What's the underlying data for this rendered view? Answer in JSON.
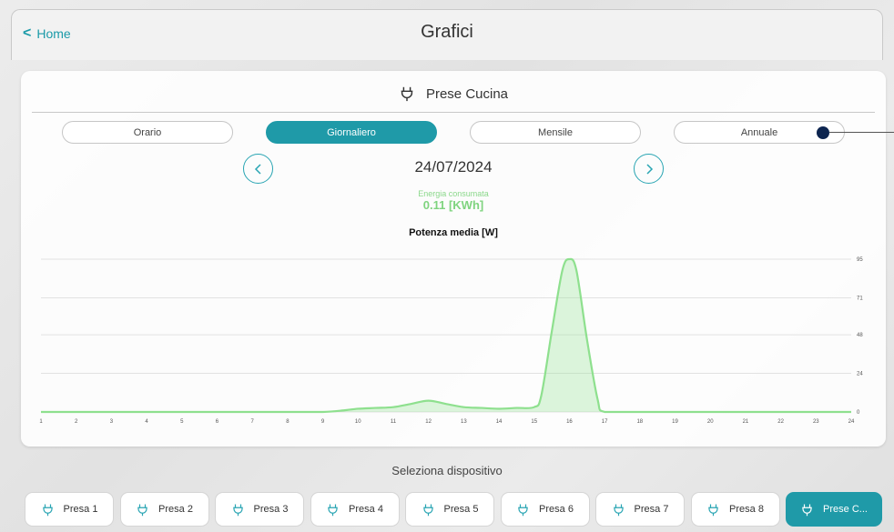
{
  "header": {
    "back_label": "Home",
    "title": "Grafici"
  },
  "device": {
    "name": "Prese Cucina"
  },
  "period_tabs": [
    {
      "label": "Orario",
      "active": false
    },
    {
      "label": "Giornaliero",
      "active": true
    },
    {
      "label": "Mensile",
      "active": false
    },
    {
      "label": "Annuale",
      "active": false
    }
  ],
  "date": "24/07/2024",
  "energy": {
    "label": "Energia consumata",
    "value": "0.11 [KWh]"
  },
  "chart_data": {
    "type": "area",
    "title": "Potenza media [W]",
    "xlabel": "",
    "ylabel": "",
    "x_ticks": [
      "1",
      "2",
      "3",
      "4",
      "5",
      "6",
      "7",
      "8",
      "9",
      "10",
      "11",
      "12",
      "13",
      "14",
      "15",
      "16",
      "17",
      "18",
      "19",
      "20",
      "21",
      "22",
      "23",
      "24"
    ],
    "y_ticks": [
      "0",
      "24",
      "48",
      "71",
      "95"
    ],
    "ylim": [
      0,
      95
    ],
    "grid": true,
    "color": "#8ee08e",
    "x": [
      1,
      2,
      3,
      4,
      5,
      6,
      7,
      8,
      9,
      9.6,
      10,
      10.5,
      11,
      11.5,
      12,
      12.5,
      13,
      13.5,
      14,
      14.5,
      15,
      15.2,
      15.5,
      15.8,
      16,
      16.2,
      16.5,
      16.8,
      17,
      18,
      19,
      20,
      21,
      22,
      23,
      24
    ],
    "y": [
      0,
      0,
      0,
      0,
      0,
      0,
      0,
      0,
      0,
      1,
      2,
      2.5,
      3,
      5,
      7,
      5,
      3,
      2.5,
      2,
      2.5,
      3,
      10,
      50,
      88,
      95,
      88,
      45,
      8,
      0,
      0,
      0,
      0,
      0,
      0,
      0,
      0
    ]
  },
  "selector": {
    "label": "Seleziona dispositivo",
    "devices": [
      {
        "label": "Presa 1",
        "active": false
      },
      {
        "label": "Presa 2",
        "active": false
      },
      {
        "label": "Presa 3",
        "active": false
      },
      {
        "label": "Presa 4",
        "active": false
      },
      {
        "label": "Presa 5",
        "active": false
      },
      {
        "label": "Presa 6",
        "active": false
      },
      {
        "label": "Presa 7",
        "active": false
      },
      {
        "label": "Presa 8",
        "active": false
      },
      {
        "label": "Prese C...",
        "active": true
      }
    ]
  },
  "colors": {
    "accent": "#1f9aa8",
    "energy": "#7fd47f"
  }
}
